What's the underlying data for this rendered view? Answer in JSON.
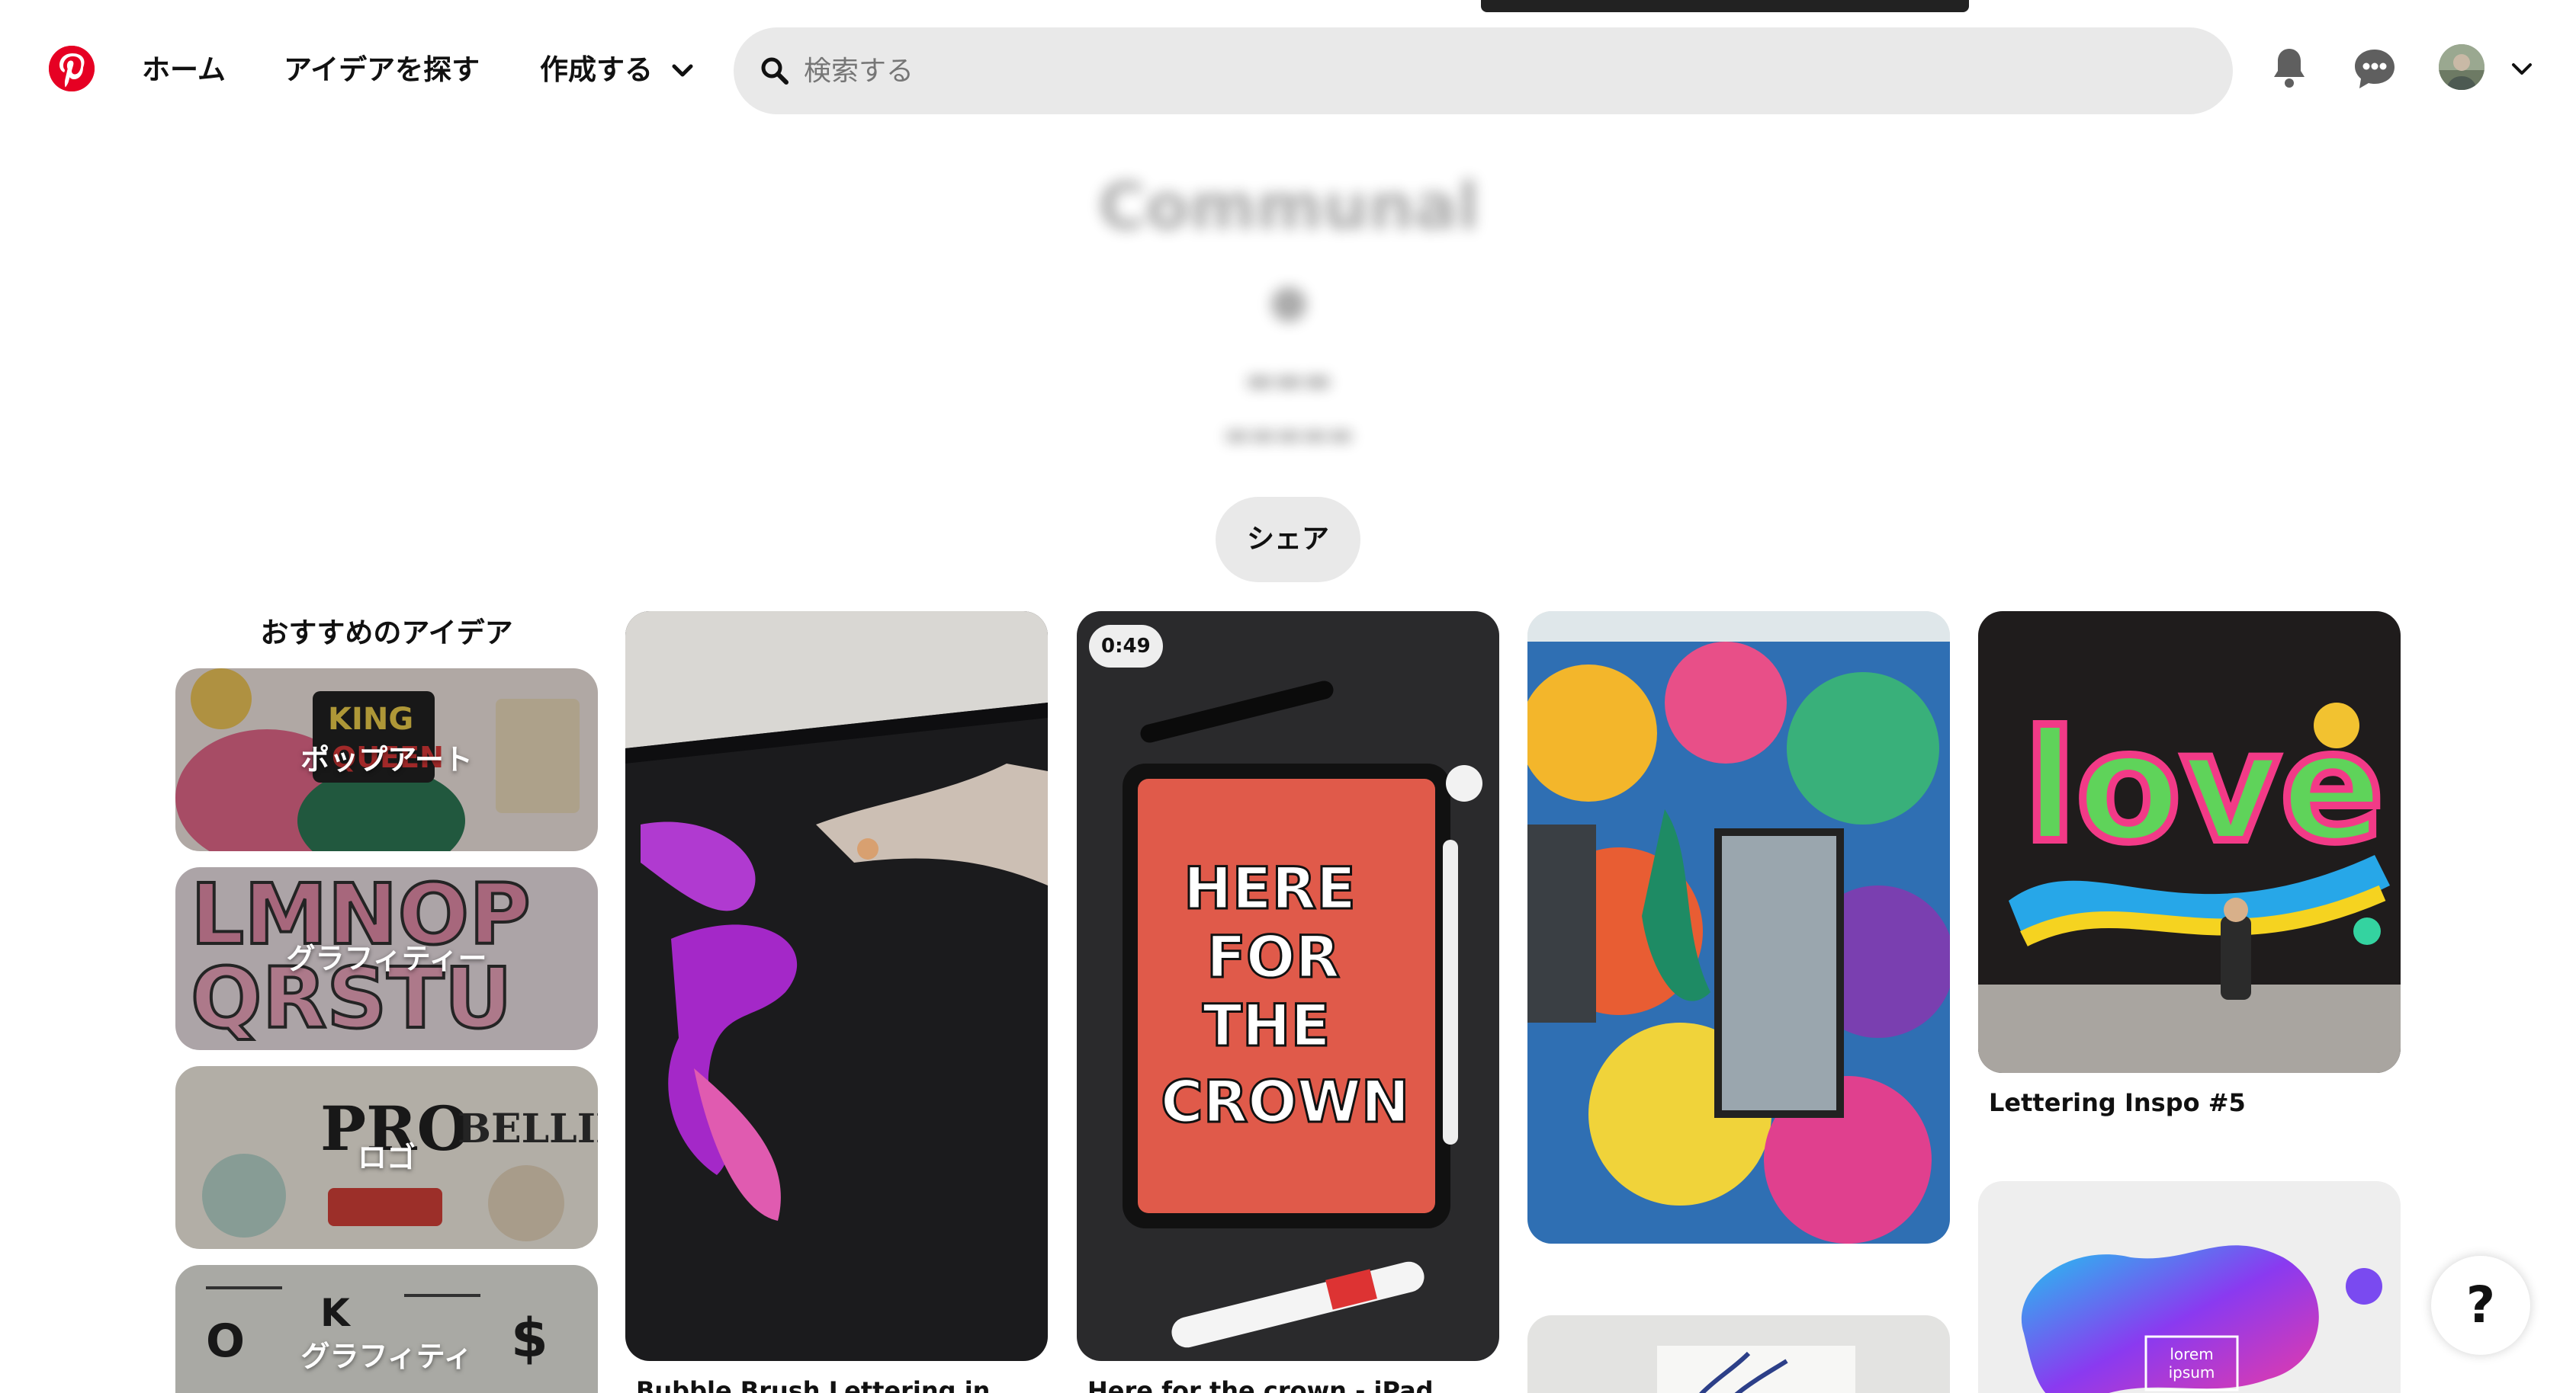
{
  "header": {
    "nav": {
      "home": "ホーム",
      "explore": "アイデアを探す",
      "create": "作成する"
    },
    "search": {
      "placeholder": "検索する",
      "value": ""
    },
    "icons": [
      "pinterest-logo",
      "chevron-down-icon",
      "search-icon",
      "bell-icon",
      "chat-icon",
      "avatar",
      "chevron-down-icon"
    ]
  },
  "board": {
    "title": "Communal",
    "share_label": "シェア"
  },
  "recommendations": {
    "heading": "おすすめのアイデア",
    "items": [
      {
        "label": "ポップアート"
      },
      {
        "label": "グラフィティー"
      },
      {
        "label": "ロゴ"
      },
      {
        "label": "グラフィティ"
      }
    ]
  },
  "pins": [
    {
      "title": "Bubble Brush Lettering in"
    },
    {
      "title": "Here for the crown - iPad",
      "duration": "0:49"
    },
    {
      "title": ""
    },
    {
      "title": "Lettering Inspo #5"
    },
    {
      "title": ""
    },
    {
      "title": "",
      "text": [
        "lorem",
        "ipsum"
      ]
    }
  ],
  "help": {
    "label": "?"
  },
  "colors": {
    "brand": "#e60023",
    "search_bg": "#e9e9e9",
    "text": "#111111"
  }
}
